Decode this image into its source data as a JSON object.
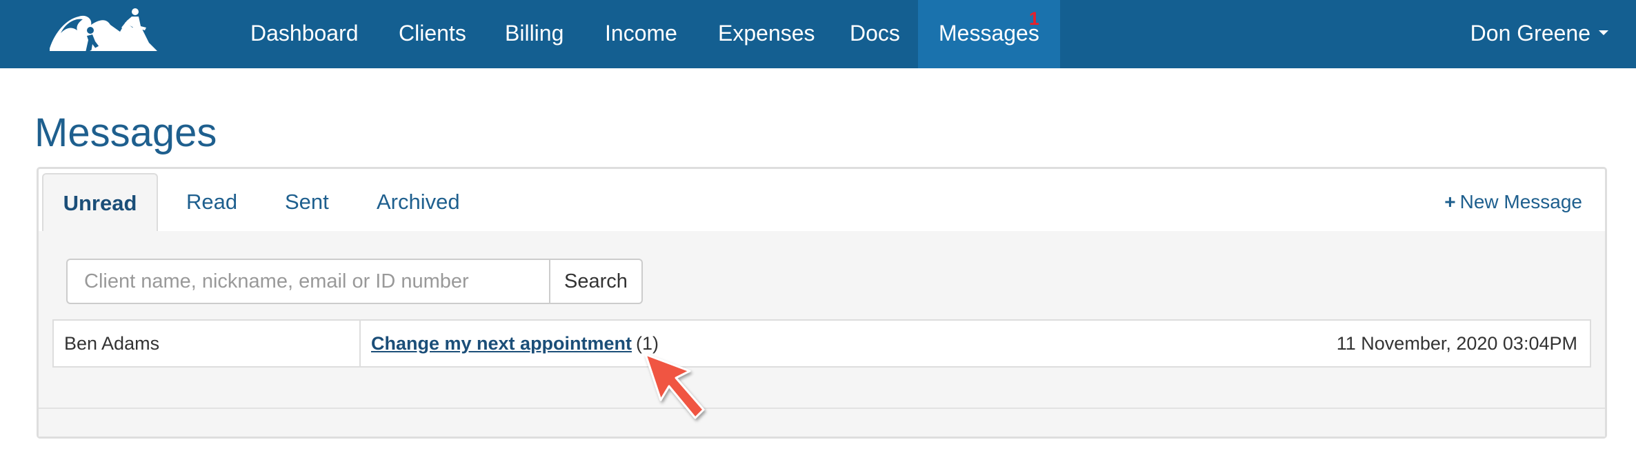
{
  "nav": {
    "items": [
      {
        "label": "Dashboard"
      },
      {
        "label": "Clients"
      },
      {
        "label": "Billing"
      },
      {
        "label": "Income"
      },
      {
        "label": "Expenses"
      },
      {
        "label": "Docs"
      },
      {
        "label": "Messages",
        "badge": "1",
        "active": true
      }
    ],
    "user": "Don Greene"
  },
  "page": {
    "title": "Messages"
  },
  "tabs": [
    {
      "label": "Unread",
      "active": true
    },
    {
      "label": "Read"
    },
    {
      "label": "Sent"
    },
    {
      "label": "Archived"
    }
  ],
  "actions": {
    "new_message": "New Message"
  },
  "search": {
    "placeholder": "Client name, nickname, email or ID number",
    "value": "",
    "button": "Search"
  },
  "messages": [
    {
      "sender": "Ben Adams",
      "subject": "Change my next appointment",
      "count": "(1)",
      "date": "11 November, 2020 03:04PM"
    }
  ],
  "colors": {
    "navbar": "#145f91",
    "nav_active": "#1a72ad",
    "badge": "#e8202a",
    "title": "#1e5f8e",
    "annotation_arrow": "#f05443"
  },
  "icons": {
    "logo": "mountain-climbers-logo",
    "user_menu": "caret-down-icon",
    "new_message": "plus-icon",
    "annotation": "arrow-pointer-icon"
  }
}
